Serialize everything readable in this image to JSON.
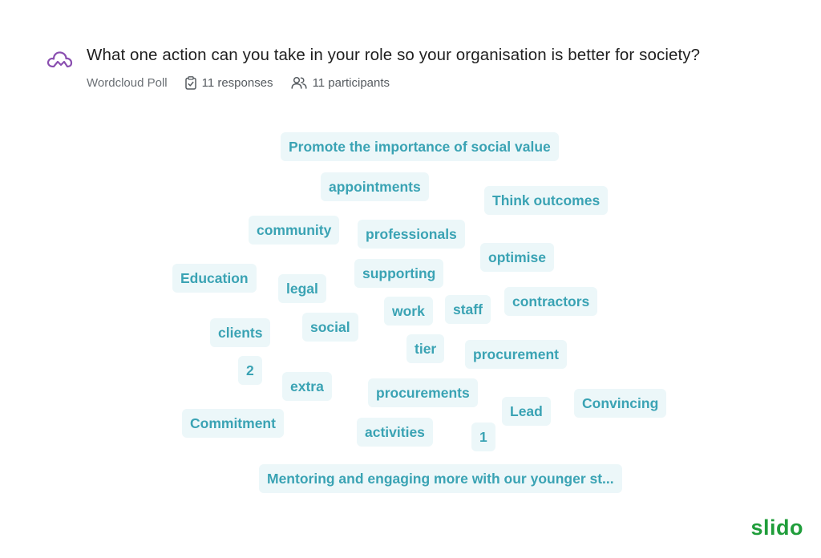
{
  "header": {
    "icon": "wordcloud-icon",
    "question": "What one action can you take in your role so your organisation is better for society?",
    "poll_type": "Wordcloud Poll",
    "responses": "11 responses",
    "participants": "11 participants"
  },
  "wordcloud": {
    "words": [
      "Promote the importance of social value",
      "appointments",
      "Think outcomes",
      "community",
      "professionals",
      "optimise",
      "supporting",
      "Education",
      "legal",
      "work",
      "staff",
      "contractors",
      "clients",
      "social",
      "tier",
      "procurement",
      "2",
      "extra",
      "procurements",
      "Convincing",
      "Lead",
      "Commitment",
      "activities",
      "1",
      "Mentoring and engaging more with our younger st..."
    ]
  },
  "brand": {
    "name": "slido"
  },
  "colors": {
    "accent": "#3aa3b4",
    "chip_bg": "#ecf7f9",
    "brand": "#1f9d3a",
    "icon": "#8a4fb0"
  }
}
